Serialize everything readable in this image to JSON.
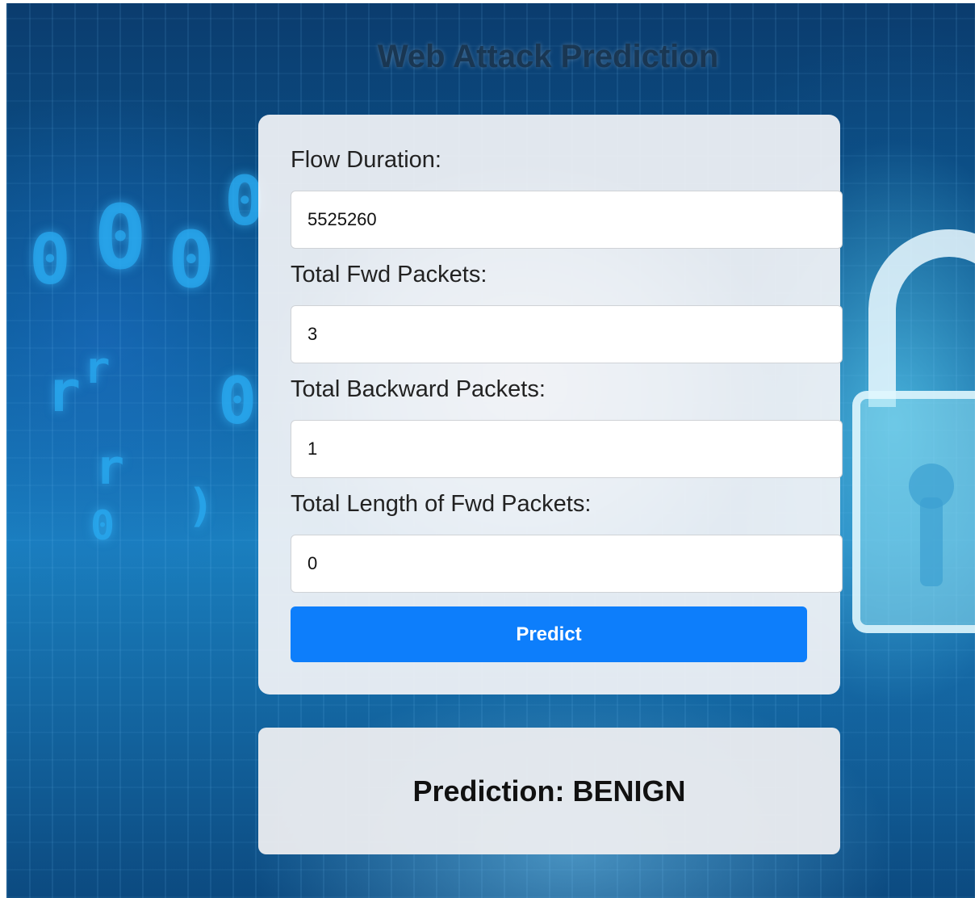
{
  "page": {
    "title": "Web Attack Prediction"
  },
  "form": {
    "fields": [
      {
        "label": "Flow Duration:",
        "value": "5525260"
      },
      {
        "label": "Total Fwd Packets:",
        "value": "3"
      },
      {
        "label": "Total Backward Packets:",
        "value": "1"
      },
      {
        "label": "Total Length of Fwd Packets:",
        "value": "0"
      }
    ],
    "submit_label": "Predict"
  },
  "result": {
    "text": "Prediction: BENIGN"
  },
  "colors": {
    "button": "#0d7efb",
    "card": "#f2f3f6"
  }
}
